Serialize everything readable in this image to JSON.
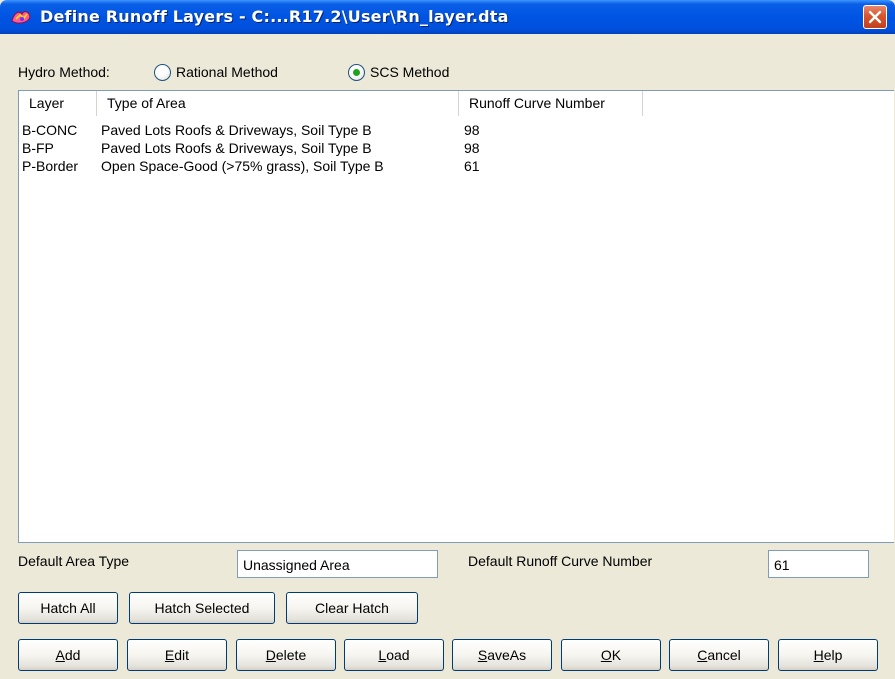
{
  "window": {
    "title": "Define Runoff Layers - C:...R17.2\\User\\Rn_layer.dta"
  },
  "hydro_method": {
    "label": "Hydro Method:",
    "options": [
      {
        "label": "Rational Method",
        "selected": false
      },
      {
        "label": "SCS Method",
        "selected": true
      }
    ]
  },
  "list": {
    "columns": [
      "Layer",
      "Type of Area",
      "Runoff Curve Number"
    ],
    "rows": [
      {
        "layer": "B-CONC",
        "type": "Paved Lots Roofs & Driveways, Soil Type B",
        "cn": "98"
      },
      {
        "layer": "B-FP",
        "type": "Paved Lots Roofs & Driveways, Soil Type B",
        "cn": "98"
      },
      {
        "layer": "P-Border",
        "type": "Open Space-Good (>75% grass), Soil Type B",
        "cn": "61"
      }
    ]
  },
  "defaults": {
    "area_type_label": "Default Area Type",
    "area_type_value": "Unassigned Area",
    "cn_label": "Default Runoff Curve Number",
    "cn_value": "61"
  },
  "hatch_buttons": {
    "hatch_all": "Hatch All",
    "hatch_selected": "Hatch Selected",
    "clear_hatch": "Clear Hatch"
  },
  "buttons": {
    "add": {
      "first": "A",
      "rest": "dd"
    },
    "edit": {
      "first": "E",
      "rest": "dit"
    },
    "delete": {
      "first": "D",
      "rest": "elete"
    },
    "load": {
      "first": "L",
      "rest": "oad"
    },
    "saveas": {
      "first": "S",
      "rest": "aveAs"
    },
    "ok": {
      "first": "O",
      "rest": "K"
    },
    "cancel": {
      "first": "C",
      "rest": "ancel"
    },
    "help": {
      "first": "H",
      "rest": "elp"
    }
  },
  "colors": {
    "titlebar": "#0054e3",
    "dialog_bg": "#ece9d8",
    "close_button": "#d8552e",
    "radio_dot": "#21a121"
  }
}
